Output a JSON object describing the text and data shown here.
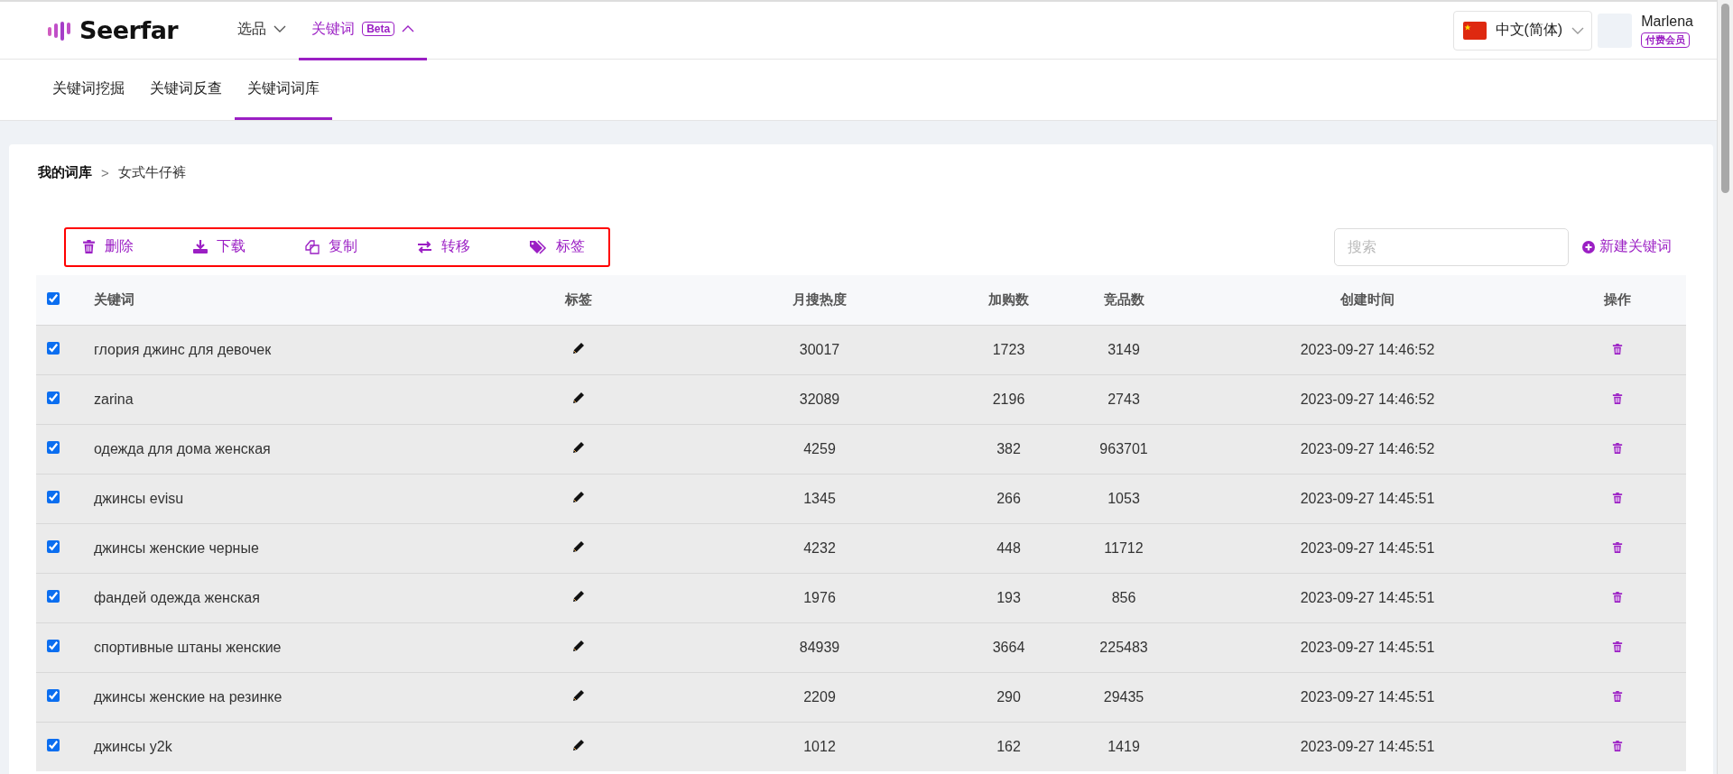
{
  "header": {
    "logo": "Seerfar",
    "nav": [
      {
        "label": "选品",
        "selected": false,
        "expanded": false
      },
      {
        "label": "关键词",
        "badge": "Beta",
        "selected": true,
        "expanded": true
      }
    ],
    "language": "中文(简体)",
    "user": {
      "name": "Marlena",
      "badge": "付费会员"
    }
  },
  "subnav": [
    {
      "label": "关键词挖掘",
      "selected": false
    },
    {
      "label": "关键词反查",
      "selected": false
    },
    {
      "label": "关键词词库",
      "selected": true
    }
  ],
  "breadcrumb": {
    "items": [
      "我的词库",
      "女式牛仔裤"
    ],
    "separator": ">"
  },
  "toolbar": [
    {
      "kind": "trash",
      "label": "删除"
    },
    {
      "kind": "download",
      "label": "下载"
    },
    {
      "kind": "copy",
      "label": "复制"
    },
    {
      "kind": "transfer",
      "label": "转移"
    },
    {
      "kind": "tag",
      "label": "标签"
    }
  ],
  "search": {
    "placeholder": "搜索"
  },
  "new_button": "新建关键词",
  "table": {
    "all_checked": true,
    "columns": [
      "关键词",
      "标签",
      "月搜热度",
      "加购数",
      "竞品数",
      "创建时间",
      "操作"
    ],
    "rows": [
      {
        "checked": true,
        "keyword": "глория джинс для девочек",
        "monthly": "30017",
        "cart": "1723",
        "competitors": "3149",
        "created": "2023-09-27 14:46:52"
      },
      {
        "checked": true,
        "keyword": "zarina",
        "monthly": "32089",
        "cart": "2196",
        "competitors": "2743",
        "created": "2023-09-27 14:46:52"
      },
      {
        "checked": true,
        "keyword": "одежда для дома женская",
        "monthly": "4259",
        "cart": "382",
        "competitors": "963701",
        "created": "2023-09-27 14:46:52"
      },
      {
        "checked": true,
        "keyword": "джинсы evisu",
        "monthly": "1345",
        "cart": "266",
        "competitors": "1053",
        "created": "2023-09-27 14:45:51"
      },
      {
        "checked": true,
        "keyword": "джинсы женские черные",
        "monthly": "4232",
        "cart": "448",
        "competitors": "11712",
        "created": "2023-09-27 14:45:51"
      },
      {
        "checked": true,
        "keyword": "фандей одежда женская",
        "monthly": "1976",
        "cart": "193",
        "competitors": "856",
        "created": "2023-09-27 14:45:51"
      },
      {
        "checked": true,
        "keyword": "спортивные штаны женские",
        "monthly": "84939",
        "cart": "3664",
        "competitors": "225483",
        "created": "2023-09-27 14:45:51"
      },
      {
        "checked": true,
        "keyword": "джинсы женские на резинке",
        "monthly": "2209",
        "cart": "290",
        "competitors": "29435",
        "created": "2023-09-27 14:45:51"
      },
      {
        "checked": true,
        "keyword": "джинсы y2k",
        "monthly": "1012",
        "cart": "162",
        "competitors": "1419",
        "created": "2023-09-27 14:45:51"
      }
    ]
  }
}
